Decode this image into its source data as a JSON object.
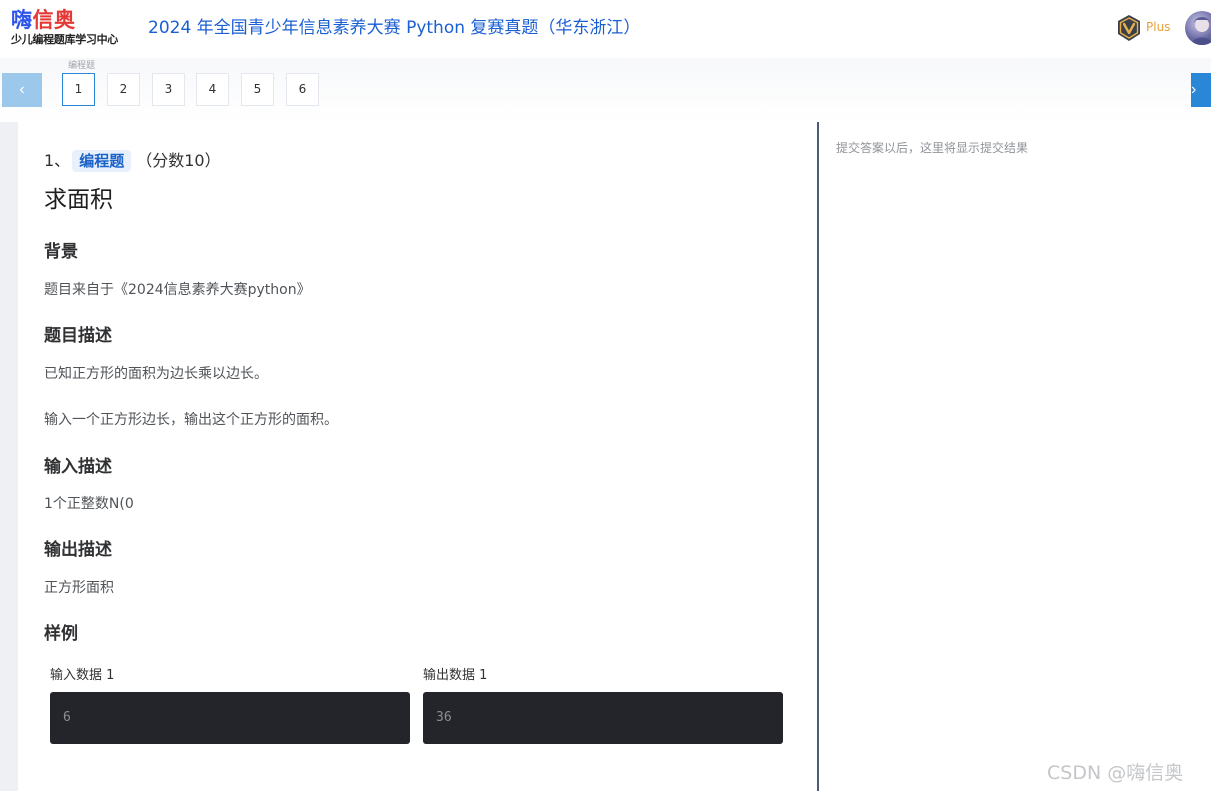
{
  "header": {
    "logo_part1": "嗨",
    "logo_part2": "信奥",
    "logo_subtitle": "少儿编程题库学习中心",
    "page_title": "2024 年全国青少年信息素养大赛 Python 复赛真题（华东浙江）",
    "plus_label": "Plus"
  },
  "nav": {
    "prev_label": "‹",
    "next_label": "›",
    "group_label": "编程题",
    "questions": [
      "1",
      "2",
      "3",
      "4",
      "5",
      "6"
    ],
    "active_index": 0
  },
  "question": {
    "number": "1、",
    "type_tag": "编程题",
    "score": "（分数10）",
    "title": "求面积",
    "background_title": "背景",
    "background_text": "题目来自于《2024信息素养大赛python》",
    "desc_title": "题目描述",
    "desc_text_1": "已知正方形的面积为边长乘以边长。",
    "desc_text_2": "输入一个正方形边长，输出这个正方形的面积。",
    "input_title": "输入描述",
    "input_text": "1个正整数N(0",
    "output_title": "输出描述",
    "output_text": "正方形面积",
    "sample_title": "样例",
    "samples": {
      "input_label": "输入数据 1",
      "input_value": "6",
      "output_label": "输出数据 1",
      "output_value": "36"
    }
  },
  "result": {
    "hint": "提交答案以后，这里将显示提交结果"
  },
  "watermark": "CSDN @嗨信奥",
  "colors": {
    "title_blue": "#1a5fd4",
    "tag_bg": "#e8f1fb",
    "nav_active_border": "#2a86d6",
    "sample_bg": "#23252a",
    "divider": "#4a5d78"
  }
}
